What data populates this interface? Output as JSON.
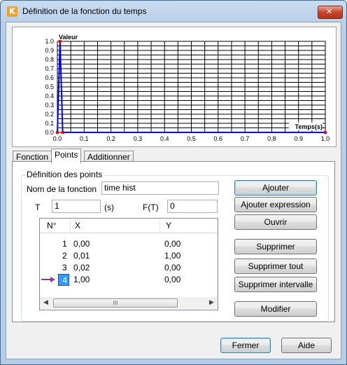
{
  "window": {
    "title": "Définition de la fonction du temps"
  },
  "chart_data": {
    "type": "line",
    "ylabel": "Valeur",
    "xlabel": "Temps(s)",
    "xlim": [
      0.0,
      1.0
    ],
    "ylim": [
      0.0,
      1.0
    ],
    "x_ticks": [
      "0.0",
      "0.1",
      "0.2",
      "0.3",
      "0.4",
      "0.5",
      "0.6",
      "0.7",
      "0.8",
      "0.9",
      "1.0"
    ],
    "y_ticks": [
      "0.0",
      "0.1",
      "0.2",
      "0.3",
      "0.4",
      "0.5",
      "0.6",
      "0.7",
      "0.8",
      "0.9",
      "1.0"
    ],
    "grid": true,
    "series": [
      {
        "x": [
          0.0,
          0.01,
          0.02,
          1.0
        ],
        "y": [
          0.0,
          1.0,
          0.0,
          0.0
        ],
        "color": "#0000ff"
      }
    ],
    "point_color": "#ff0000"
  },
  "tabs": [
    {
      "label": "Fonction",
      "active": false
    },
    {
      "label": "Points",
      "active": true
    },
    {
      "label": "Additionner fonctions",
      "active": false
    }
  ],
  "group": {
    "title": "Définition des points"
  },
  "form": {
    "name_label": "Nom de la fonction",
    "name_value": "time hist",
    "t_label": "T",
    "t_value": "1",
    "t_unit": "(s)",
    "ft_label": "F(T)",
    "ft_value": "0"
  },
  "table": {
    "headers": [
      "N°",
      "X",
      "Y"
    ],
    "rows": [
      {
        "n": "1",
        "x": "0,00",
        "y": "0,00"
      },
      {
        "n": "2",
        "x": "0,01",
        "y": "1,00"
      },
      {
        "n": "3",
        "x": "0,02",
        "y": "0,00"
      },
      {
        "n": "4",
        "x": "1,00",
        "y": "0,00"
      }
    ],
    "selected_row": 3,
    "scroll_thumb": "III"
  },
  "buttons": {
    "ajouter": "Ajouter",
    "ajouter_expression": "Ajouter expression",
    "ouvrir": "Ouvrir",
    "supprimer": "Supprimer",
    "supprimer_tout": "Supprimer tout",
    "supprimer_intervalle": "Supprimer intervalle",
    "modifier": "Modifier",
    "fermer": "Fermer",
    "aide": "Aide"
  }
}
